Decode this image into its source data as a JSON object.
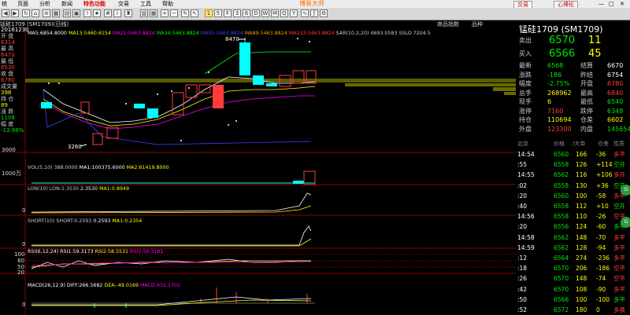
{
  "menu": [
    "统",
    "页面",
    "分析",
    "新闻",
    "特色功能",
    "交易",
    "工具",
    "帮助"
  ],
  "app_title": "博易大师",
  "top_buttons": {
    "trade": "交易",
    "self": "心博化"
  },
  "window_controls": [
    "—",
    "□",
    "✕"
  ],
  "chart_title": "锰硅1709 (SM1709)(日线)",
  "left_panel": [
    {
      "label": "20161230",
      "value": ""
    },
    {
      "label": "开 盘",
      "value": "6314"
    },
    {
      "label": "最 高",
      "value": "6470"
    },
    {
      "label": "最 低",
      "value": "6530"
    },
    {
      "label": "收 盘",
      "value": "6780"
    },
    {
      "label": "成交量",
      "value": "398"
    },
    {
      "label": "持 仓",
      "value": "89"
    },
    {
      "label": "涨 跌",
      "value": "1108"
    },
    {
      "label": "幅 度",
      "value": "-13.98%"
    }
  ],
  "ma_legend": [
    {
      "text": "MA5:6854.8000",
      "color": "#ffffff"
    },
    {
      "text": "MA13:5460.6154",
      "color": "#ffff00"
    },
    {
      "text": "MA21:5463.8824",
      "color": "#ff00ff"
    },
    {
      "text": "MA34:5463.8824",
      "color": "#00ff00"
    },
    {
      "text": "MA55:5463.8824",
      "color": "#4040ff"
    },
    {
      "text": "MA89:5463.8824",
      "color": "#ff9900"
    },
    {
      "text": "MA233:5463.8824",
      "color": "#ff3b3b"
    },
    {
      "text": "SAR(10,2,20)  4693.0583",
      "color": "#cccccc"
    },
    {
      "text": "SSLO  7204.5",
      "color": "#cccccc"
    }
  ],
  "price_labels": {
    "high": "8470",
    "low": "3260",
    "axis_bottom": "3000"
  },
  "vol_axis": "1000万",
  "indicators": {
    "vol": [
      {
        "text": "VOL(5,10)  388.0000",
        "color": "#cccccc"
      },
      {
        "text": "MA1:100375.6000",
        "color": "#ffffff"
      },
      {
        "text": "MA2:61419.8000",
        "color": "#ffff00"
      }
    ],
    "lon": [
      {
        "text": "LON(10)  LON:2.3530",
        "color": "#cccccc"
      },
      {
        "text": "2.3530",
        "color": "#ffffff"
      },
      {
        "text": "MA1:0.8949",
        "color": "#ffff00"
      }
    ],
    "short": [
      {
        "text": "SHORT(10)  SHORT:0.2593",
        "color": "#cccccc"
      },
      {
        "text": "0.2593",
        "color": "#ffffff"
      },
      {
        "text": "MA1:0.2354",
        "color": "#ffff00"
      }
    ],
    "rsi": [
      {
        "text": "RSI(6,12,24)  RSI1:59.3173",
        "color": "#ffffff"
      },
      {
        "text": "RSI2:58.5531",
        "color": "#ffff00"
      },
      {
        "text": "RSI3:56.3182",
        "color": "#ff00ff"
      }
    ],
    "macd": [
      {
        "text": "MACD(26,12,9)  DIFF:266.5682",
        "color": "#ffffff"
      },
      {
        "text": "DEA:-49.0169",
        "color": "#ffff00"
      },
      {
        "text": "MACD:631.1702",
        "color": "#ff00ff"
      }
    ]
  },
  "axis_zero": "0",
  "rsi_axis": [
    "100",
    "80",
    "50",
    "20",
    "0"
  ],
  "quote": {
    "title": "锰硅1709 (SM1709)",
    "tabs": [
      "商品指数",
      "品种"
    ],
    "sell": {
      "label": "卖出",
      "price": "6570",
      "qty": "11"
    },
    "buy": {
      "label": "买入",
      "price": "6566",
      "qty": "45"
    },
    "rows": [
      {
        "l1": "最新",
        "v1": "6568",
        "c1": "g",
        "l2": "结算",
        "v2": "6670",
        "c2": "w"
      },
      {
        "l1": "涨跌",
        "v1": "-186",
        "c1": "g",
        "l2": "昨结",
        "v2": "6754",
        "c2": "w"
      },
      {
        "l1": "幅度",
        "v1": "-2.75%",
        "c1": "g",
        "l2": "开盘",
        "v2": "6780",
        "c2": "r"
      },
      {
        "l1": "总手",
        "v1": "268962",
        "c1": "y",
        "l2": "最高",
        "v2": "6840",
        "c2": "r"
      },
      {
        "l1": "现手",
        "v1": "6",
        "c1": "y",
        "l2": "最低",
        "v2": "6540",
        "c2": "g"
      },
      {
        "l1": "涨停",
        "v1": "7160",
        "c1": "r",
        "l2": "跌停",
        "v2": "6348",
        "c2": "g"
      },
      {
        "l1": "持仓",
        "v1": "110694",
        "c1": "y",
        "l2": "仓差",
        "v2": "6602",
        "c2": "y"
      },
      {
        "l1": "外盘",
        "v1": "123300",
        "c1": "r",
        "l2": "内盘",
        "v2": "145654",
        "c2": "g"
      }
    ],
    "trade_header": [
      "北京",
      "价格",
      "/大单",
      "仓差",
      "性质"
    ],
    "trades": [
      {
        "time": "14:54",
        "price": "6560",
        "vol": "166",
        "chg": "-36",
        "type": "多平",
        "tc": "r"
      },
      {
        "time": ":55",
        "price": "6558",
        "vol": "126",
        "chg": "+114",
        "type": "空开",
        "tc": "g"
      },
      {
        "time": "14:55",
        "price": "6562",
        "vol": "116",
        "chg": "+106",
        "type": "多开",
        "tc": "r"
      },
      {
        "time": ":02",
        "price": "6558",
        "vol": "130",
        "chg": "+36",
        "type": "空开",
        "tc": "g"
      },
      {
        "time": ":20",
        "price": "6560",
        "vol": "100",
        "chg": "-58",
        "type": "多平",
        "tc": "r"
      },
      {
        "time": ":40",
        "price": "6558",
        "vol": "112",
        "chg": "+10",
        "type": "空开",
        "tc": "g"
      },
      {
        "time": "14:56",
        "price": "6558",
        "vol": "110",
        "chg": "-26",
        "type": "空平",
        "tc": "r"
      },
      {
        "time": ":20",
        "price": "6556",
        "vol": "124",
        "chg": "-60",
        "type": "多平",
        "tc": "g"
      },
      {
        "time": "14:58",
        "price": "6562",
        "vol": "148",
        "chg": "-70",
        "type": "多平",
        "tc": "r"
      },
      {
        "time": "14:59",
        "price": "6562",
        "vol": "128",
        "chg": "-94",
        "type": "多平",
        "tc": "r"
      },
      {
        "time": ":12",
        "price": "6564",
        "vol": "274",
        "chg": "-236",
        "type": "多平",
        "tc": "r"
      },
      {
        "time": ":18",
        "price": "6570",
        "vol": "206",
        "chg": "-186",
        "type": "空平",
        "tc": "r"
      },
      {
        "time": ":26",
        "price": "6570",
        "vol": "148",
        "chg": "-74",
        "type": "空平",
        "tc": "r"
      },
      {
        "time": ":42",
        "price": "6570",
        "vol": "108",
        "chg": "-90",
        "type": "多平",
        "tc": "r"
      },
      {
        "time": ":50",
        "price": "6566",
        "vol": "100",
        "chg": "-100",
        "type": "多平",
        "tc": "g"
      },
      {
        "time": ":52",
        "price": "6572",
        "vol": "180",
        "chg": "0",
        "type": "多换",
        "tc": "r"
      }
    ]
  },
  "side_button": "G"
}
